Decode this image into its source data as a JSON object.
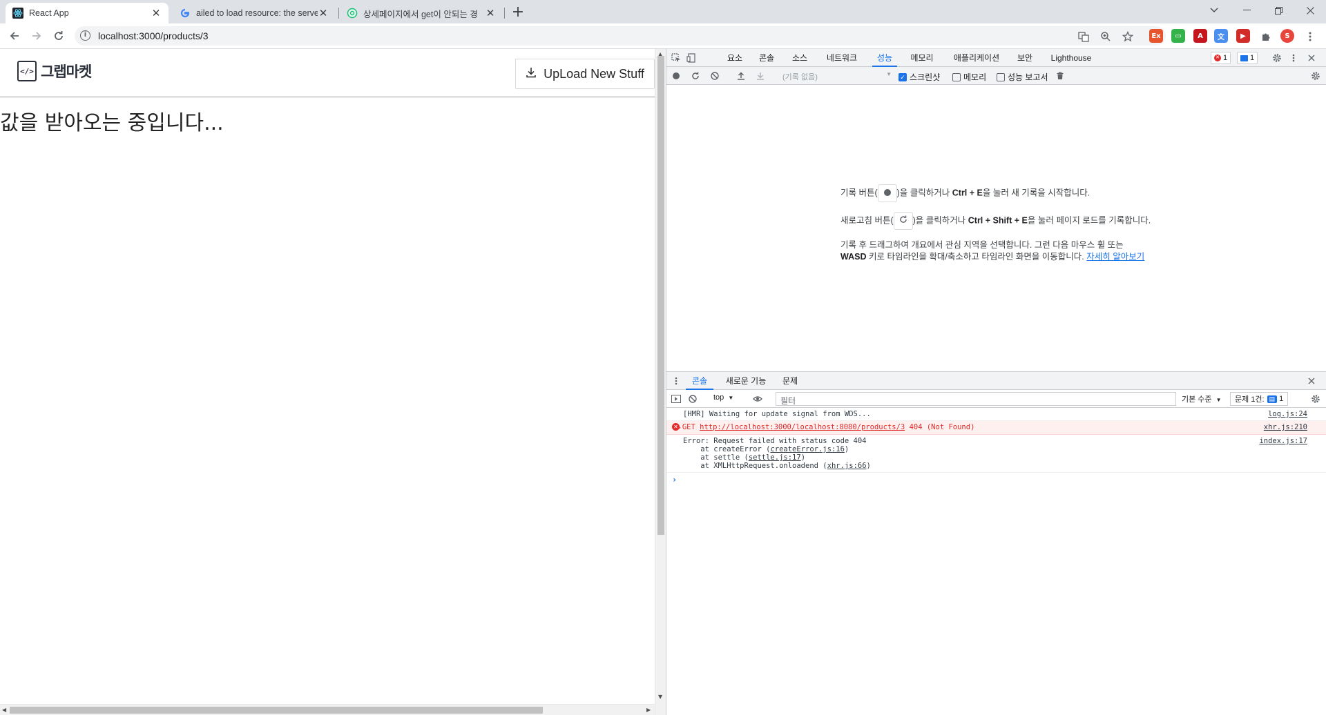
{
  "browser": {
    "tabs": [
      {
        "title": "React App",
        "active": true,
        "favicon": "react-icon"
      },
      {
        "title": "ailed to load resource: the serve",
        "active": false,
        "favicon": "google-icon"
      },
      {
        "title": "상세페이지에서 get이 안되는 경",
        "active": false,
        "favicon": "inflearn-icon"
      }
    ],
    "new_tab_label": "+",
    "url": "localhost:3000/products/3"
  },
  "page": {
    "logo_mark": "</>",
    "logo_text": "그랩마켓",
    "upload_button_label": "UpLoad New Stuff",
    "loading_text": "값을 받아오는 중입니다..."
  },
  "devtools": {
    "tabs": [
      "요소",
      "콘솔",
      "소스",
      "네트워크",
      "성능",
      "메모리",
      "애플리케이션",
      "보안",
      "Lighthouse"
    ],
    "active_tab": "성능",
    "error_count": "1",
    "message_count": "1",
    "perf_toolbar": {
      "recording_placeholder": "(기록 없음)",
      "screenshots_label": "스크린샷",
      "memory_label": "메모리",
      "web_vitals_label": "성능 보고서"
    },
    "perf_landing": {
      "line1_a": "기록 버튼(",
      "line1_b": ")을 클릭하거나 ",
      "line1_kbd": "Ctrl + E",
      "line1_c": "을 눌러 새 기록을 시작합니다.",
      "line2_a": "새로고침 버튼(",
      "line2_b": ")을 클릭하거나 ",
      "line2_kbd": "Ctrl + Shift + E",
      "line2_c": "을 눌러 페이지 로드를 기록합니다.",
      "line3_a": "기록 후 드래그하여 개요에서 관심 지역을 선택합니다. 그런 다음 마우스 휠 또는 ",
      "line3_kbd": "WASD",
      "line3_b": " 키로 타임라인을 확대/축소하고 타임라인 화면을 이동합니다. ",
      "line3_link": "자세히 알아보기"
    },
    "drawer": {
      "tabs": [
        "콘솔",
        "새로운 기능",
        "문제"
      ],
      "active_tab": "콘솔",
      "context": "top",
      "filter_placeholder": "필터",
      "levels_label": "기본 수준",
      "issues_label": "문제 1건:",
      "issues_count": "1",
      "messages": [
        {
          "text": "[HMR] Waiting for update signal from WDS...",
          "source": "log.js:24",
          "level": "info"
        },
        {
          "method": "GET",
          "url": "http://localhost:3000/localhost:8080/products/3",
          "status": "404 (Not Found)",
          "source": "xhr.js:210",
          "level": "error"
        },
        {
          "text": "Error: Request failed with status code 404",
          "source": "index.js:17",
          "level": "info",
          "stack": [
            {
              "pre": "    at createError (",
              "file": "createError.js:16",
              "post": ")"
            },
            {
              "pre": "    at settle (",
              "file": "settle.js:17",
              "post": ")"
            },
            {
              "pre": "    at XMLHttpRequest.onloadend (",
              "file": "xhr.js:66",
              "post": ")"
            }
          ]
        }
      ],
      "prompt": "›"
    }
  },
  "colors": {
    "accent": "#1a73e8",
    "error": "#e02a2a",
    "tabstrip": "#dee1e6"
  }
}
